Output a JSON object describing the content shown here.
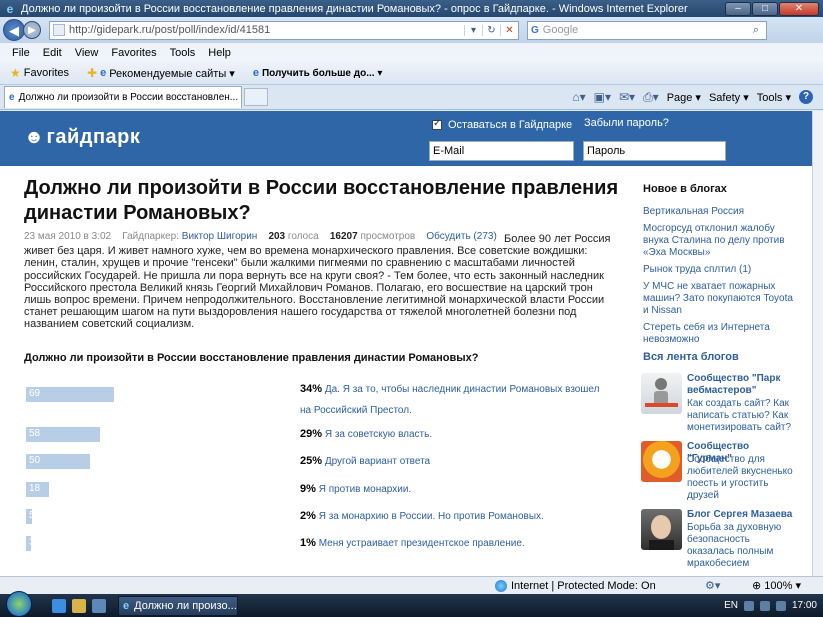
{
  "window": {
    "title": "Должно ли произойти в России восстановление правления династии Романовых? - опрос в Гайдпарке. - Windows Internet Explorer"
  },
  "address_bar": {
    "url": "http://gidepark.ru/post/poll/index/id/41581",
    "search_placeholder": "Google"
  },
  "menu": [
    "File",
    "Edit",
    "View",
    "Favorites",
    "Tools",
    "Help"
  ],
  "favorites_bar": {
    "favorites_label": "Favorites",
    "items": [
      "Рекомендуемые сайты ▾",
      "Получить больше до... ▾"
    ]
  },
  "tabs": {
    "active_tab": "Должно ли произойти в России восстановлен...",
    "commands": [
      "Page ▾",
      "Safety ▾",
      "Tools ▾"
    ]
  },
  "site": {
    "logo": "гайдпарк",
    "remember_label": "Оставаться в Гайдпарке",
    "forgot_label": "Забыли пароль?",
    "email_value": "E-Mail",
    "password_value": "Пароль"
  },
  "article": {
    "title": "Должно ли произойти в России восстановление правления династии Романовых?",
    "date": "23 мая 2010 в 3:02",
    "author_label": "Гайдпаркер:",
    "author": "Виктор Шигорин",
    "votes_count": "203",
    "votes_label": "голоса",
    "views_count": "16207",
    "views_label": "просмотров",
    "discuss": "Обсудить (273)",
    "body": "Более 90 лет Россия живет без царя. И живет намного хуже, чем во времена монархического правления. Все советские вождишки: ленин, сталин, хрущев  и прочие \"генсеки\" были жалкими пигмеями по сравнению с масштабами личностей российских Государей. Не пришла ли пора вернуть все на круги своя? - Тем более, что есть законный наследник Российского престола Великий князь Георгий Михайлович Романов. Полагаю, его восшествие на царский трон лишь вопрос времени. Причем непродолжительного. Восстановление легитимной монархической власти России станет решающим шагом на пути выздоровления нашего государства от тяжелой многолетней болезни под названием советский социализм."
  },
  "poll": {
    "question": "Должно ли произойти в России восстановление правления династии Романовых?",
    "options": [
      {
        "votes": "69",
        "votes_num": 69,
        "percent": "34%",
        "text": "Да. Я за то, чтобы наследник династии Романовых взошел на Российский Престол."
      },
      {
        "votes": "58",
        "votes_num": 58,
        "percent": "29%",
        "text": "Я за советскую власть."
      },
      {
        "votes": "50",
        "votes_num": 50,
        "percent": "25%",
        "text": "Другой вариант ответа"
      },
      {
        "votes": "18",
        "votes_num": 18,
        "percent": "9%",
        "text": "Я против монархии."
      },
      {
        "votes": "5",
        "votes_num": 5,
        "percent": "2%",
        "text": "Я за монархию в России. Но против Романовых."
      },
      {
        "votes": "3",
        "votes_num": 3,
        "percent": "1%",
        "text": "Меня устраивает президентское правление."
      }
    ]
  },
  "sidebar": {
    "blogs_title": "Новое в блогах",
    "blogs": [
      "Вертикальная Россия",
      "Мосгорсуд отклонил жалобу внука Сталина по делу против «Эха Москвы»",
      "Рынок труда сплтил (1)",
      "У МЧС не хватает пожарных машин? Зато покупаются Toyota и Nissan",
      "Стереть себя из Интернета невозможно"
    ],
    "all_blogs": "Вся лента блогов",
    "communities": [
      {
        "title": "Сообщество \"Парк вебмастеров\"",
        "desc": "Как создать сайт? Как написать статью? Как монетизировать сайт?"
      },
      {
        "title": "Сообщество \"Гурман\"",
        "desc": "Сообщество для любителей вкусненько поесть и угостить друзей"
      },
      {
        "title": "Блог Сергея Мазаева",
        "desc": "Борьба за духовную безопасность оказалась полным мракобесием"
      }
    ]
  },
  "status": {
    "zone": "Internet | Protected Mode: On",
    "zoom": "100%"
  },
  "taskbar": {
    "task": "Должно ли произо...",
    "lang": "EN",
    "clock": "17:00"
  },
  "colors": {
    "header_blue": "#2f66a7",
    "link_blue": "#2f5f9f",
    "bar_fill": "#b8cde6"
  }
}
